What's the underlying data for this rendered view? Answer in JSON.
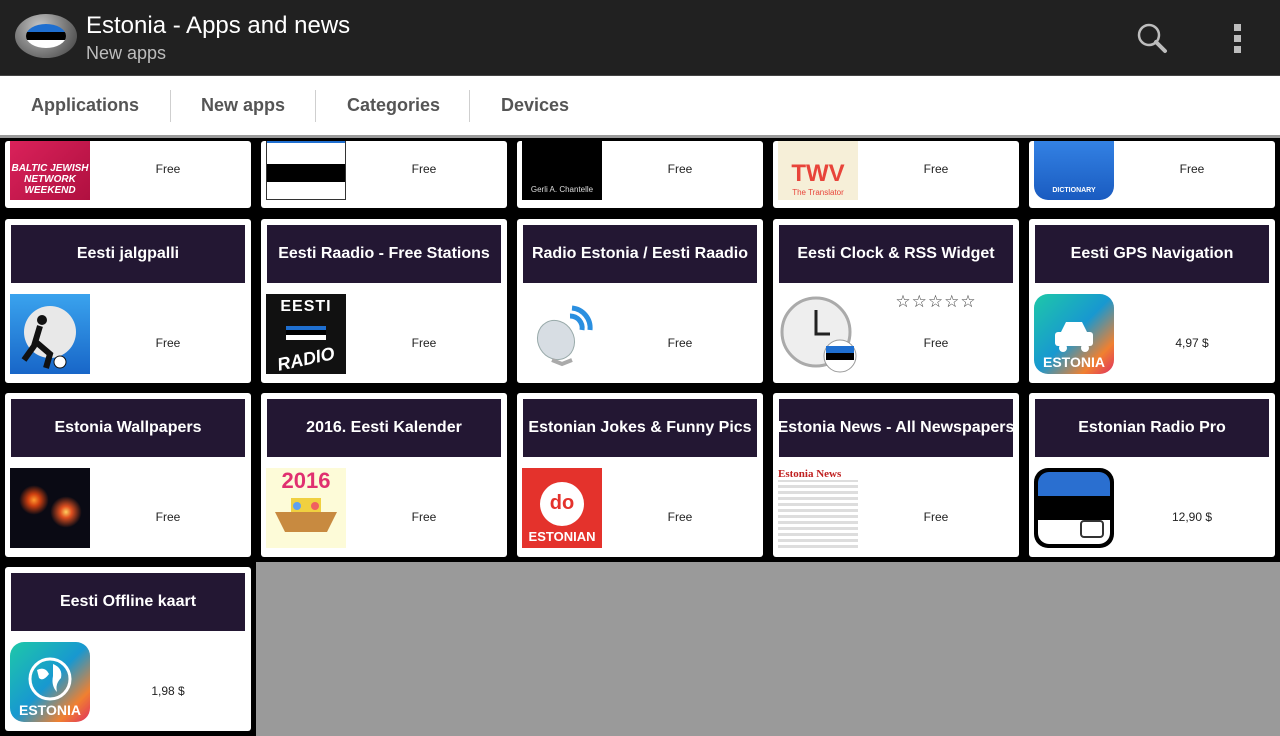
{
  "header": {
    "title": "Estonia - Apps and news",
    "subtitle": "New apps",
    "icons": {
      "app": "estonia-flag-app-icon",
      "search": "search-icon",
      "overflow": "overflow-menu-icon"
    }
  },
  "tabs": [
    {
      "label": "Applications"
    },
    {
      "label": "New apps"
    },
    {
      "label": "Categories"
    },
    {
      "label": "Devices"
    }
  ],
  "partial_row": [
    {
      "price": "Free",
      "icon_text": "BALTIC JEWISH NETWORK WEEKEND"
    },
    {
      "price": "Free",
      "icon_text": ""
    },
    {
      "price": "Free",
      "icon_text": "Gerli A. Chantelle"
    },
    {
      "price": "Free",
      "icon_text": "TWV",
      "icon_subtext": "The Translator"
    },
    {
      "price": "Free",
      "icon_text": "DICTIONARY"
    }
  ],
  "apps": [
    {
      "title": "Eesti jalgpalli",
      "price": "Free"
    },
    {
      "title": "Eesti Raadio - Free Stations",
      "price": "Free",
      "icon_text": "EESTI",
      "icon_subtext": "RADIO"
    },
    {
      "title": "Radio Estonia / Eesti Raadio",
      "price": "Free"
    },
    {
      "title": "Eesti Clock & RSS Widget",
      "price": "Free",
      "rating": "☆☆☆☆☆"
    },
    {
      "title": "Eesti GPS Navigation",
      "price": "4,97 $",
      "icon_text": "ESTONIA"
    },
    {
      "title": "Estonia Wallpapers",
      "price": "Free"
    },
    {
      "title": "2016. Eesti Kalender",
      "price": "Free",
      "icon_text": "2016"
    },
    {
      "title": "Estonian Jokes & Funny Pics",
      "price": "Free",
      "icon_text": "ESTONIAN"
    },
    {
      "title": "Estonia News - All Newspapers",
      "price": "Free",
      "icon_text": "Estonia News"
    },
    {
      "title": "Estonian Radio Pro",
      "price": "12,90 $"
    },
    {
      "title": "Eesti Offline kaart",
      "price": "1,98 $",
      "icon_text": "ESTONIA"
    }
  ]
}
